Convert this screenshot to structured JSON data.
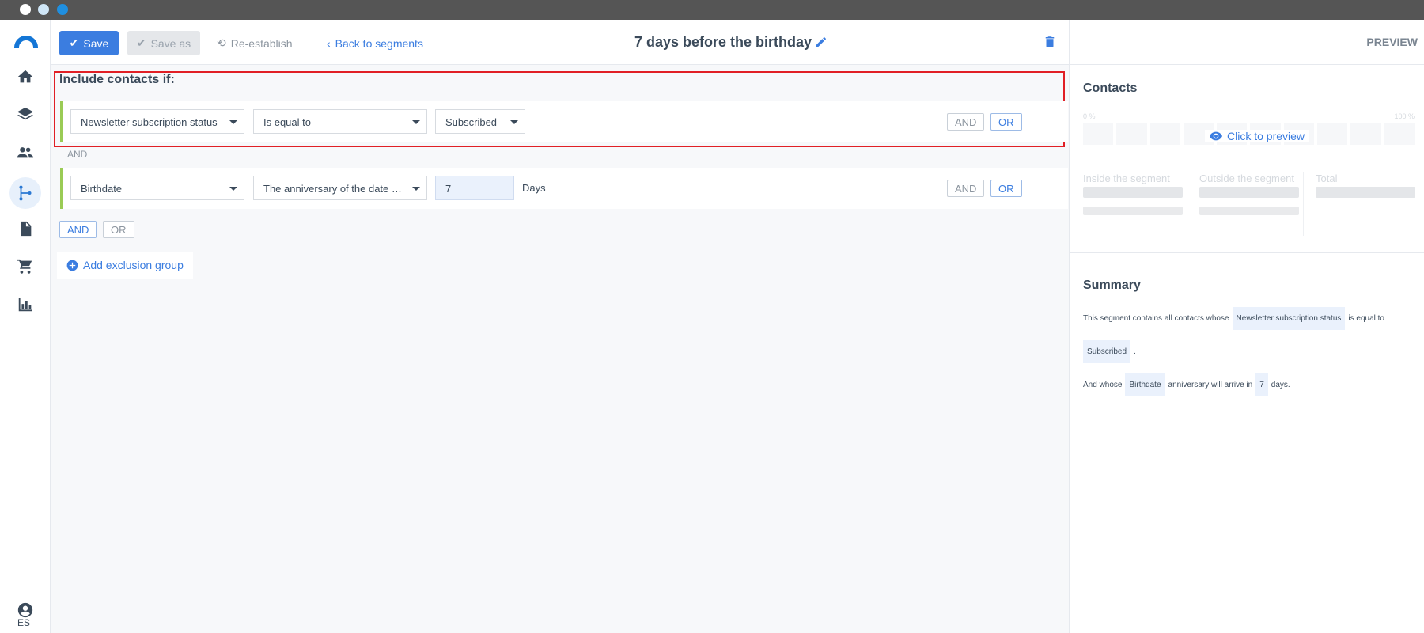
{
  "toolbar": {
    "save_label": "Save",
    "save_as_label": "Save as",
    "reestablish_label": "Re-establish",
    "back_label": "Back to segments",
    "title": "7 days before the birthday"
  },
  "nav": {
    "language": "ES",
    "items": [
      "home-icon",
      "layers-icon",
      "contacts-icon",
      "segments-icon",
      "document-icon",
      "cart-icon",
      "chart-icon"
    ]
  },
  "include": {
    "title": "Include contacts if:",
    "rule1": {
      "field": "Newsletter subscription status",
      "operator": "Is equal to",
      "value": "Subscribed",
      "and_label": "AND",
      "or_label": "OR"
    },
    "separator": "AND",
    "rule2": {
      "field": "Birthdate",
      "operator": "The anniversary of the date …",
      "value": "7",
      "unit": "Days",
      "and_label": "AND",
      "or_label": "OR"
    },
    "group_and": "AND",
    "group_or": "OR",
    "add_exclusion": "Add exclusion group"
  },
  "preview": {
    "header": "PREVIEW",
    "contacts_title": "Contacts",
    "scale_min": "0 %",
    "scale_max": "100 %",
    "click_to_preview": "Click to preview",
    "inside_label": "Inside the segment",
    "outside_label": "Outside the segment",
    "total_label": "Total"
  },
  "summary": {
    "title": "Summary",
    "line1_prefix": "This segment contains all contacts whose",
    "line1_tag": "Newsletter subscription status",
    "line1_suffix": "is equal to",
    "line2_tag": "Subscribed",
    "line2_suffix": ".",
    "line3_prefix": "And whose",
    "line3_tag": "Birthdate",
    "line3_mid": "anniversary will arrive in",
    "line3_tag2": "7",
    "line3_suffix": "days."
  },
  "colors": {
    "accent": "#3b7de0",
    "highlight_border": "#e11f25",
    "rule_bar": "#9acb55"
  }
}
